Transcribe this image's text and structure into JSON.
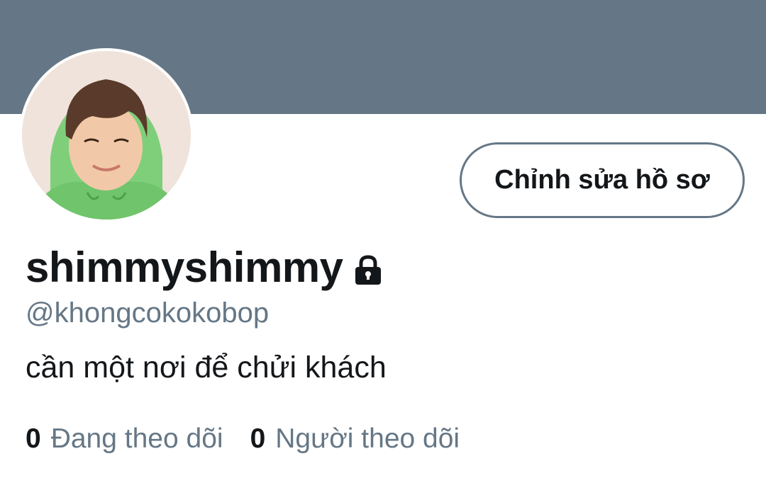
{
  "profile": {
    "display_name": "shimmyshimmy",
    "handle": "@khongcokokobop",
    "bio": "cần một nơi để chửi khách",
    "locked_icon": "lock-icon",
    "avatar_icon": "profile-photo"
  },
  "actions": {
    "edit_profile_label": "Chỉnh sửa hồ sơ"
  },
  "stats": {
    "following_count": "0",
    "following_label": "Đang theo dõi",
    "followers_count": "0",
    "followers_label": "Người theo dõi"
  },
  "colors": {
    "banner": "#657786",
    "text_primary": "#14171a",
    "text_secondary": "#657786"
  }
}
